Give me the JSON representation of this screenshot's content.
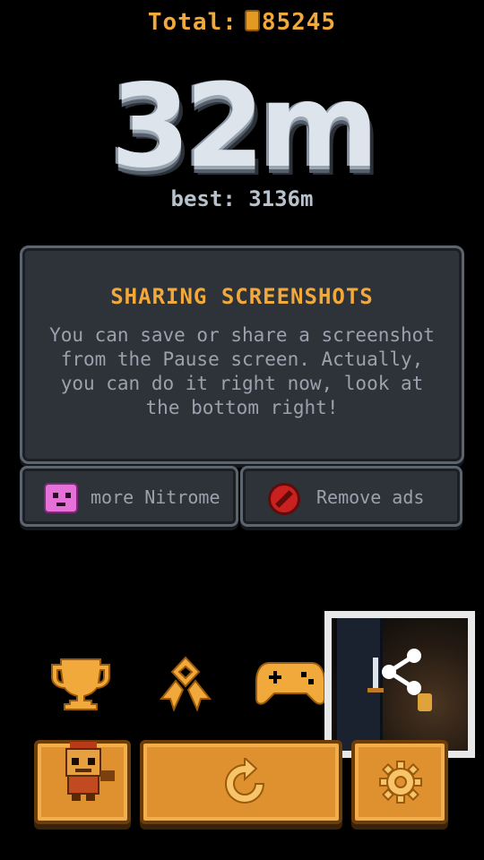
{
  "hud": {
    "total_label": "Total:",
    "total_value": "85245",
    "distance": "32m",
    "best": "best: 3136m"
  },
  "tip_panel": {
    "title": "SHARING SCREENSHOTS",
    "body": "You can save or share a screenshot from the Pause screen. Actually, you can do it right now, look at the bottom right!"
  },
  "buttons": {
    "more_nitrome": "more Nitrome",
    "remove_ads": "Remove ads"
  },
  "icons": {
    "trophy": "trophy-icon",
    "medal": "medal-icon",
    "gamepad": "gamepad-icon",
    "share": "share-icon",
    "replay": "replay-icon",
    "settings": "gear-icon",
    "character": "character-icon"
  },
  "colors": {
    "accent_orange": "#f2a93b",
    "button_orange": "#e0912f",
    "panel_bg": "#2e3239",
    "text_grey": "#9aa2ad"
  }
}
